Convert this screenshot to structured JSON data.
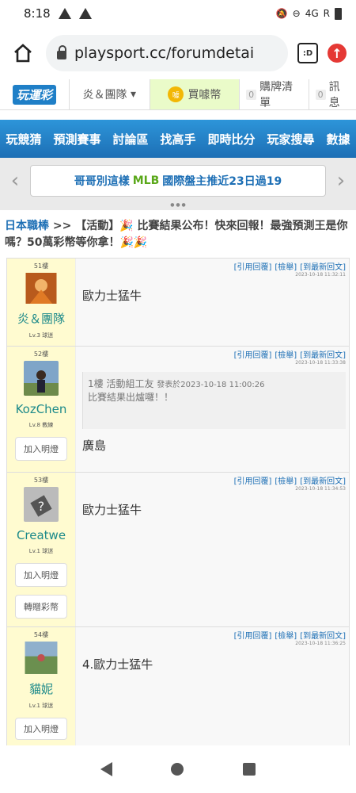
{
  "status": {
    "time": "8:18",
    "network": "4G",
    "roaming": "R"
  },
  "browser": {
    "url": "playsport.cc/forumdetai",
    "tabs_label": ":D"
  },
  "site": {
    "logo": "玩運彩",
    "team_menu": "炎＆團隊",
    "coins_label": "買噱幣",
    "coin_badge": "噱",
    "cart": {
      "count": "0",
      "label": "購牌清單"
    },
    "messages": {
      "count": "0",
      "label": "訊息"
    }
  },
  "nav": {
    "items": [
      "玩競猜",
      "預測賽事",
      "討論區",
      "找高手",
      "即時比分",
      "玩家搜尋",
      "數據"
    ]
  },
  "banner": {
    "prefix": "哥哥別這樣",
    "highlight": "MLB",
    "suffix": "國際盤主推近23日過19"
  },
  "breadcrumb": {
    "category": "日本職棒",
    "separator": ">>",
    "title": "【活動】🎉 比賽結果公布！快來回報！最強預測王是你嗎？50萬彩幣等你拿！🎉🎉"
  },
  "post_actions": {
    "quote": "[引用回覆]",
    "report": "[檢舉]",
    "latest": "[到最新回文]"
  },
  "posts": [
    {
      "floor": "51樓",
      "user": "炎＆團隊",
      "level": "Lv.3 球迷",
      "timestamp": "2023-10-18 11:32:11",
      "content": "歐力士猛牛",
      "buttons": []
    },
    {
      "floor": "52樓",
      "user": "KozChen",
      "level": "Lv.8 教練",
      "timestamp": "2023-10-18 11:33:38",
      "quote_header": "1樓 活動組工友",
      "quote_meta": "發表於2023-10-18 11:00:26",
      "quote_text": "比賽結果出爐囉！！",
      "content": "廣島",
      "buttons": [
        "加入明燈"
      ]
    },
    {
      "floor": "53樓",
      "user": "Creatwe",
      "level": "Lv.1 球迷",
      "timestamp": "2023-10-18 11:34:53",
      "content": "歐力士猛牛",
      "buttons": [
        "加入明燈",
        "轉贈彩幣"
      ]
    },
    {
      "floor": "54樓",
      "user": "貓妮",
      "level": "Lv.1 球迷",
      "timestamp": "2023-10-18 11:36:25",
      "content": "4.歐力士猛牛",
      "buttons": [
        "加入明燈"
      ]
    }
  ]
}
